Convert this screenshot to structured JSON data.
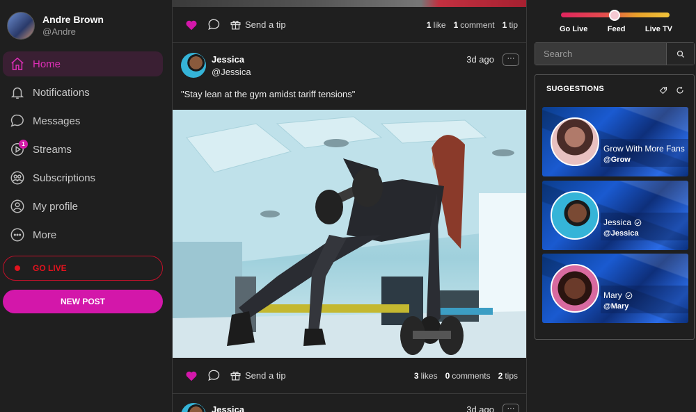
{
  "user": {
    "name": "Andre Brown",
    "handle": "@Andre"
  },
  "nav": [
    {
      "label": "Home",
      "icon": "home-icon",
      "active": true
    },
    {
      "label": "Notifications",
      "icon": "bell-icon"
    },
    {
      "label": "Messages",
      "icon": "chat-bubble-icon"
    },
    {
      "label": "Streams",
      "icon": "play-icon",
      "badge": "1"
    },
    {
      "label": "Subscriptions",
      "icon": "users-icon"
    },
    {
      "label": "My profile",
      "icon": "user-circle-icon"
    },
    {
      "label": "More",
      "icon": "more-dots-icon"
    }
  ],
  "go_live_label": "GO LIVE",
  "new_post_label": "NEW POST",
  "feed": {
    "tip_label": "Send a tip",
    "post_top_stats": {
      "likes": "1",
      "likes_label": "like",
      "comments": "1",
      "comments_label": "comment",
      "tips": "1",
      "tips_label": "tip"
    },
    "post": {
      "author": "Jessica",
      "handle": "@Jessica",
      "time": "3d ago",
      "more": "···",
      "text": "\"Stay lean at the gym amidst tariff tensions\"",
      "image": "woman doing dumbbell row plank in gym",
      "stats": {
        "likes": "3",
        "likes_label": "likes",
        "comments": "0",
        "comments_label": "comments",
        "tips": "2",
        "tips_label": "tips"
      }
    },
    "next_post": {
      "author": "Jessica",
      "time": "3d ago",
      "more": "···"
    }
  },
  "mode_switch": {
    "labels": [
      "Go Live",
      "Feed",
      "Live TV"
    ],
    "selected": "Feed"
  },
  "search": {
    "placeholder": "Search"
  },
  "suggestions": {
    "title": "SUGGESTIONS",
    "items": [
      {
        "name": "Grow With More Fans",
        "handle": "@Grow",
        "verified": false
      },
      {
        "name": "Jessica",
        "handle": "@Jessica",
        "verified": true
      },
      {
        "name": "Mary",
        "handle": "@Mary",
        "verified": true
      }
    ]
  },
  "colors": {
    "accent": "#d317aa",
    "live_red": "#e2131e",
    "bg": "#1f1f1f"
  }
}
